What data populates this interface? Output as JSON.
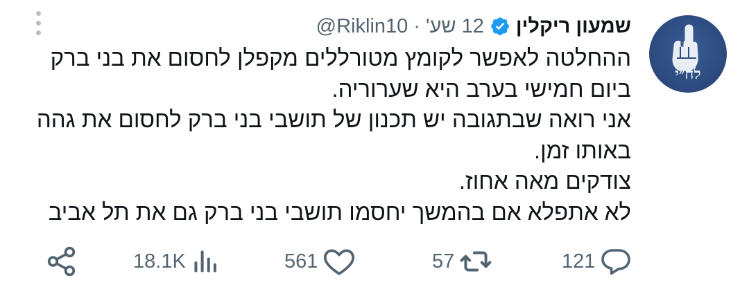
{
  "tweet": {
    "author": {
      "display_name": "שמעון ריקלין",
      "handle": "@Riklin10",
      "verified": true,
      "avatar_text": "לח״י"
    },
    "time_ago": "12 שע'",
    "separator": "·",
    "lines": [
      "ההחלטה לאפשר לקומץ מטורללים מקפלן לחסום את בני ברק",
      "ביום חמישי בערב היא שערוריה.",
      "אני רואה שבתגובה יש תכנון של תושבי בני ברק לחסום את גהה",
      "באותו זמן.",
      "צודקים מאה אחוז.",
      "לא אתפלא אם בהמשך יחסמו תושבי בני ברק גם את תל אביב"
    ],
    "actions": {
      "replies": "121",
      "retweets": "57",
      "likes": "561",
      "views": "18.1K"
    }
  },
  "icons": {
    "verified": "verified-badge-icon",
    "more": "more-vertical-icon",
    "reply": "reply-icon",
    "retweet": "retweet-icon",
    "like": "heart-icon",
    "views": "views-icon",
    "share": "share-icon"
  },
  "colors": {
    "text": "#0f1419",
    "secondary": "#536471",
    "verified": "#1d9bf0",
    "avatar_bg": "#2d4c80"
  }
}
